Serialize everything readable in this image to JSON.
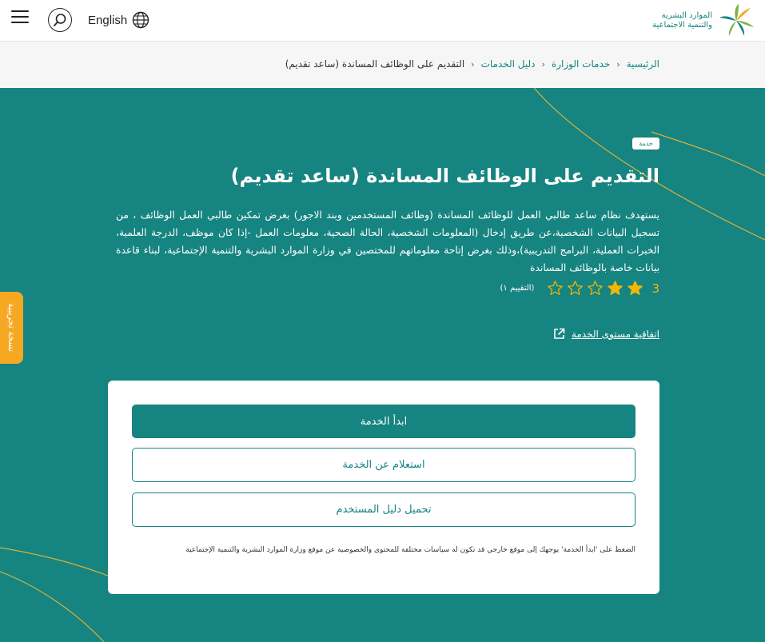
{
  "header": {
    "language_label": "English",
    "logo_line1": "الموارد البشرية",
    "logo_line2": "والتنمية الاجتماعية"
  },
  "breadcrumb": [
    {
      "label": "الرئيسية"
    },
    {
      "label": "خدمات الوزارة"
    },
    {
      "label": "دليل الخدمات"
    },
    {
      "label": "التقديم على الوظائف المساندة (ساعد تقديم)"
    }
  ],
  "service": {
    "badge": "خدمة",
    "title": "التقديم على الوظائف المساندة (ساعد تقديم)",
    "description": "يستهدف نظام ساعد طالبي العمل للوظائف المساندة (وظائف المستخدمين وبند الاجور) بغرض تمكين طالبي العمل الوظائف ، من تسجيل البيانات الشخصية،عن طريق إدخال (المعلومات الشخصية، الحالة الصحية، معلومات العمل -إذا كان موظف، الدرجة العلمية، الخبرات العملية، البرامج التدريبية)،وذلك بغرض إتاحة معلوماتهم للمختصين في وزارة الموارد البشرية والتنمية الإجتماعية، لبناء قاعدة بيانات خاصة بالوظائف المساندة",
    "rating_value": "3",
    "rating_stars": 2,
    "rating_max": 5,
    "rating_count": "(التقييم ١)",
    "sla_link": "اتفاقية مستوى الخدمة"
  },
  "beta_label": "نسخة تجريبية",
  "card": {
    "start_button": "ابدأ الخدمة",
    "inquiry_button": "استعلام عن الخدمة",
    "guide_button": "تحميل دليل المستخدم",
    "notice": "الضغط على 'ابدأ الخدمة' يوجهك إلى موقع خارجي قد تكون له سياسات مختلفة للمحتوى والخصوصية عن موقع وزارة الموارد البشرية والتنمية الإجتماعية"
  },
  "colors": {
    "brand": "#168480",
    "star": "#f2b705",
    "beta": "#f7a823"
  }
}
